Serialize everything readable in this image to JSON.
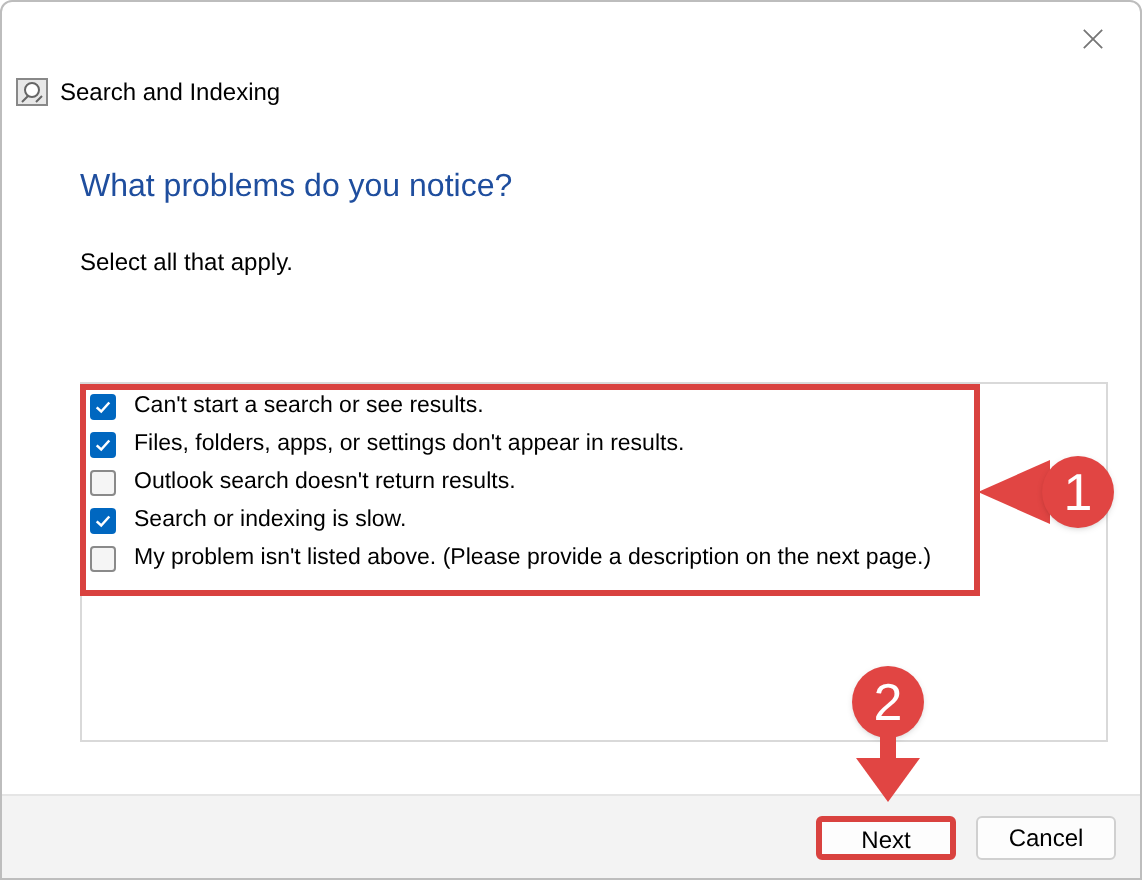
{
  "window": {
    "title": "Search and Indexing"
  },
  "heading": "What problems do you notice?",
  "instruction": "Select all that apply.",
  "options": [
    {
      "label": "Can't start a search or see results.",
      "checked": true
    },
    {
      "label": "Files, folders, apps, or settings don't appear in results.",
      "checked": true
    },
    {
      "label": "Outlook search doesn't return results.",
      "checked": false
    },
    {
      "label": "Search or indexing is slow.",
      "checked": true
    },
    {
      "label": "My problem isn't listed above. (Please provide a description on the next page.)",
      "checked": false
    }
  ],
  "buttons": [
    {
      "label": "Next",
      "highlighted": true
    },
    {
      "label": "Cancel",
      "highlighted": false
    }
  ],
  "annotations": [
    {
      "label": "1",
      "kind": "left"
    },
    {
      "label": "2",
      "kind": "down"
    }
  ]
}
